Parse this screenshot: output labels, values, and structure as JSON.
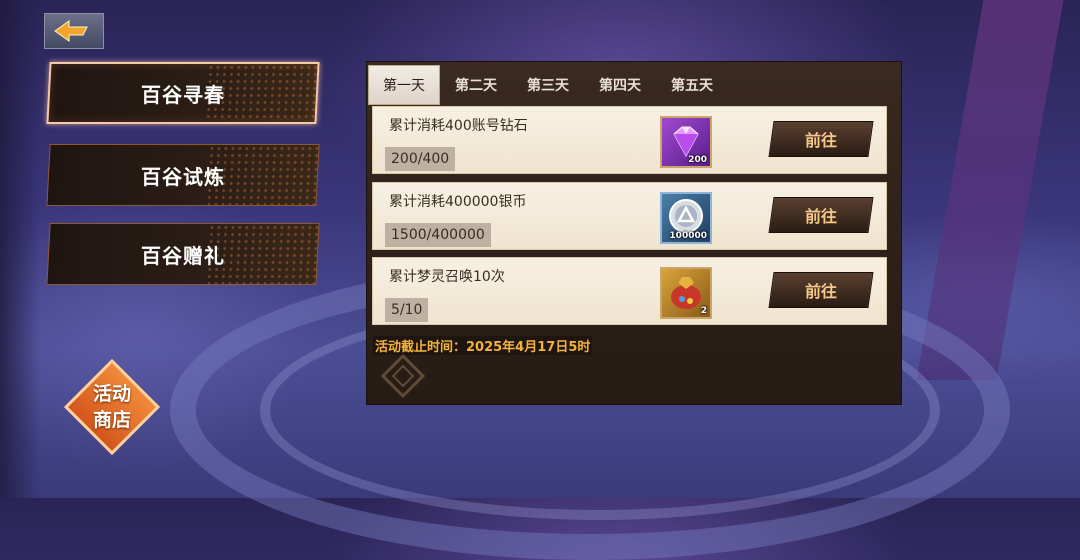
{
  "nav": {
    "back_label": "",
    "back_icon": "back-arrow-icon"
  },
  "side_tabs": [
    {
      "label": "百谷寻春",
      "active": true
    },
    {
      "label": "百谷试炼",
      "active": false
    },
    {
      "label": "百谷赠礼",
      "active": false
    }
  ],
  "shop": {
    "line1": "活动",
    "line2": "商店"
  },
  "day_tabs": [
    {
      "label": "第一天",
      "active": true
    },
    {
      "label": "第二天",
      "active": false
    },
    {
      "label": "第三天",
      "active": false
    },
    {
      "label": "第四天",
      "active": false
    },
    {
      "label": "第五天",
      "active": false
    }
  ],
  "tasks": [
    {
      "name": "累计消耗400账号钻石",
      "progress": "200/400",
      "item_icon": "purple-diamond-icon",
      "item_count": "200",
      "button": "前往"
    },
    {
      "name": "累计消耗400000银币",
      "progress": "1500/400000",
      "item_icon": "silver-coin-icon",
      "item_count": "100000",
      "button": "前往"
    },
    {
      "name": "累计梦灵召唤10次",
      "progress": "5/10",
      "item_icon": "treasure-bag-icon",
      "item_count": "2",
      "button": "前往"
    }
  ],
  "deadline": "活动截止时间：2025年4月17日5时",
  "colors": {
    "accent": "#f3b33a",
    "tab_active_border": "#f3c9a8",
    "shop": "#e06a28"
  }
}
